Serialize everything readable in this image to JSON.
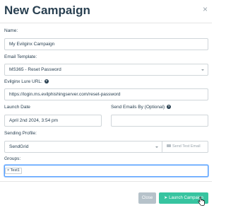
{
  "modal": {
    "title": "New Campaign",
    "close_icon": "×"
  },
  "form": {
    "name_label": "Name:",
    "name_value": "My Evilginx Campaign",
    "email_template_label": "Email Template:",
    "email_template_value": "MS365 - Reset Password",
    "lure_url_label": "Evilginx Lure URL:",
    "lure_url_value": "https://login.ms.evilphishingserver.com/reset-password",
    "launch_date_label": "Launch Date",
    "launch_date_value": "April 2nd 2024, 3:54 pm",
    "send_by_label": "Send Emails By (Optional)",
    "send_by_value": "",
    "sending_profile_label": "Sending Profile:",
    "sending_profile_value": "SendGrid",
    "send_test_label": "Send Test Email",
    "groups_label": "Groups:",
    "groups": [
      "Test1"
    ]
  },
  "footer": {
    "close_label": "Close",
    "launch_label": "Launch Campaign"
  },
  "colors": {
    "accent_launch": "#37c4a0",
    "close_button": "#b6c2ca",
    "focus_border": "#5aa2ff",
    "text": "#283f50"
  },
  "icons": {
    "help": "question-circle-icon",
    "send_test": "envelope-icon",
    "launch": "rocket-icon"
  }
}
